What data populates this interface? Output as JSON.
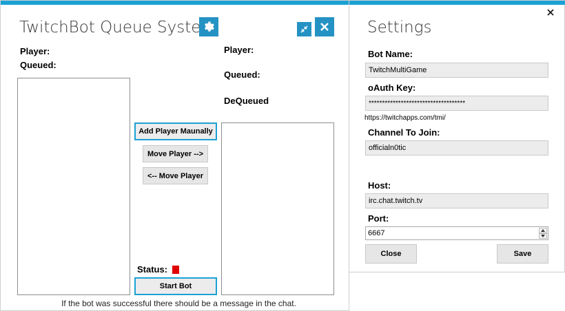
{
  "main": {
    "title": "TwitchBot Queue System",
    "player_label_left": "Player:",
    "queued_label_left": "Queued:",
    "player_label_right": "Player:",
    "queued_label_right": "Queued:",
    "dequeued_label": "DeQueued",
    "add_player_button": "Add Player Maunally",
    "move_right_button": "Move Player -->",
    "move_left_button": "<-- Move Player",
    "status_label": "Status:",
    "status_color": "#e00000",
    "start_button": "Start Bot",
    "footer_text": "If the bot was successful there should be a message in the chat."
  },
  "settings": {
    "title": "Settings",
    "bot_name_label": "Bot Name:",
    "bot_name_value": "TwitchMultiGame",
    "oauth_label": "oAuth Key:",
    "oauth_value": "************************************",
    "oauth_hint": "https://twitchapps.com/tmi/",
    "channel_label": "Channel To Join:",
    "channel_value": "officialn0tic",
    "host_label": "Host:",
    "host_value": "irc.chat.twitch.tv",
    "port_label": "Port:",
    "port_value": "6667",
    "close_button": "Close",
    "save_button": "Save"
  },
  "colors": {
    "accent": "#1ba1d4",
    "icon_button": "#2592c4"
  }
}
